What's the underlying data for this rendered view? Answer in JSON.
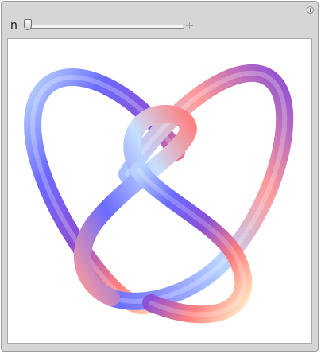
{
  "controls": {
    "slider_variable": "n",
    "slider_value_fraction": 0.0
  },
  "graphic": {
    "description_icon": "knot-3d-tube",
    "tube_colors": {
      "light_blue": "#b9d3ff",
      "blue": "#6b6bff",
      "purple": "#8c4fd6",
      "pink": "#ff9a9a",
      "salmon": "#ff7f7f",
      "cream": "#fff0c8"
    }
  }
}
